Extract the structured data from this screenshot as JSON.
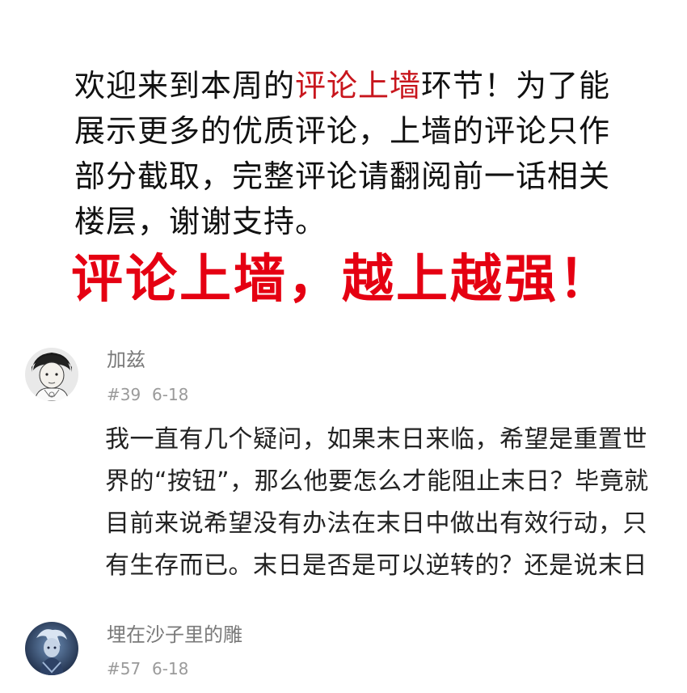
{
  "intro": {
    "text_before": "欢迎来到本周的",
    "highlight": "评论上墙",
    "text_after": "环节！为了能展示更多的优质评论，上墙的评论只作部分截取，完整评论请翻阅前一话相关楼层，谢谢支持。"
  },
  "slogan": "评论上墙，越上越强！",
  "colors": {
    "highlight": "#c8161d",
    "slogan": "#e50012",
    "author": "#7a7a7a",
    "meta": "#9a9a9a"
  },
  "comments": [
    {
      "author": "加兹",
      "floor": "#39",
      "date": "6-18",
      "text": "我一直有几个疑问，如果末日来临，希望是重置世界的“按钮”，那么他要怎么才能阻止末日？毕竟就目前来说希望没有办法在末日中做出有效行动，只有生存而已。末日是否是可以逆转的？还是说末日",
      "avatar_icon": "user-avatar-manga-boy"
    },
    {
      "author": "埋在沙子里的雕",
      "floor": "#57",
      "date": "6-18",
      "text": "",
      "avatar_icon": "user-avatar-blue-character"
    }
  ]
}
